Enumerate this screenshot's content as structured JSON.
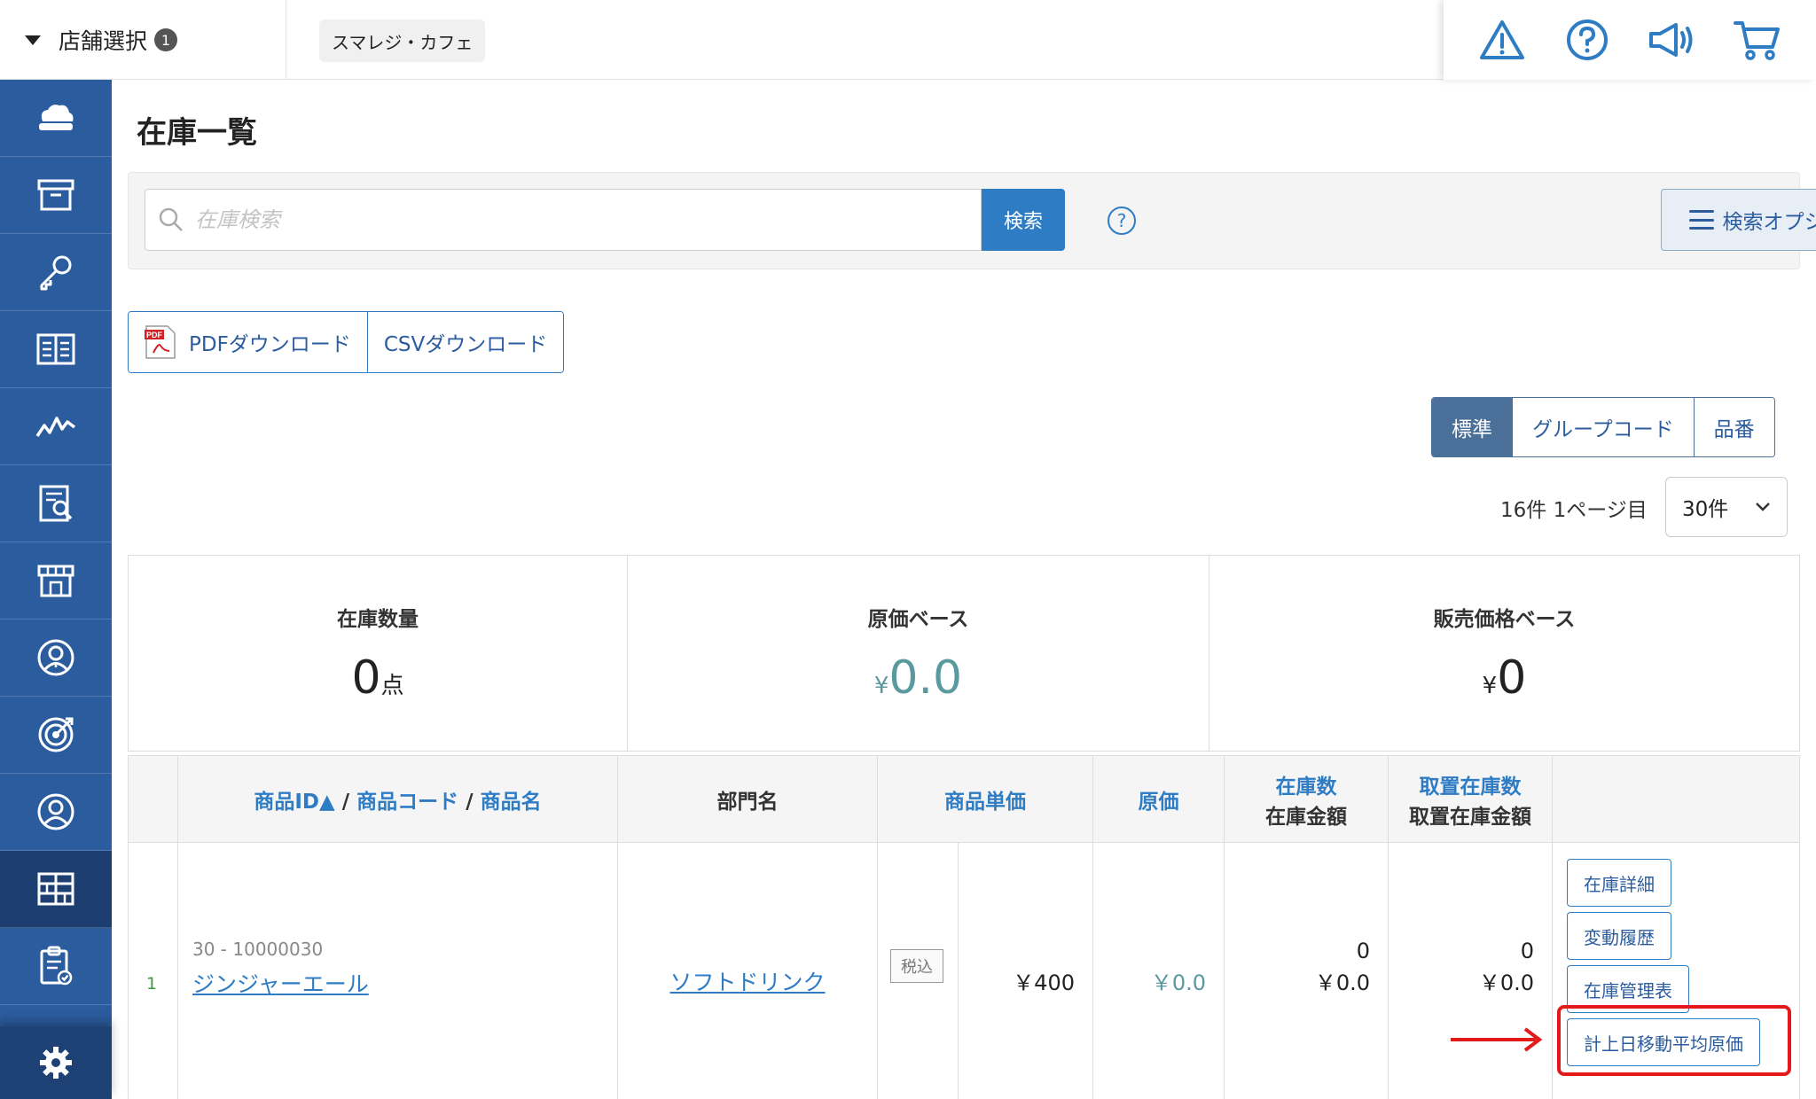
{
  "header": {
    "store_select_label": "店舗選択",
    "store_count": "1",
    "store_chip": "スマレジ・カフェ",
    "icons": [
      "warning-icon",
      "help-icon",
      "megaphone-icon",
      "cart-icon"
    ]
  },
  "sidebar": {
    "items": [
      "cloud-register-icon",
      "archive-icon",
      "key-icon",
      "book-icon",
      "chart-icon",
      "report-icon",
      "store-icon",
      "staff-icon",
      "target-icon",
      "customer-icon",
      "inventory-icon",
      "clipboard-icon"
    ],
    "active_index": 10,
    "settings_icon": "gear-icon"
  },
  "page": {
    "title": "在庫一覧"
  },
  "search": {
    "placeholder": "在庫検索",
    "button": "検索",
    "help": "?",
    "options_button": "検索オプション"
  },
  "downloads": {
    "pdf": "PDFダウンロード",
    "csv": "CSVダウンロード",
    "pdf_badge": "PDF"
  },
  "view_tabs": [
    {
      "label": "標準",
      "active": true
    },
    {
      "label": "グループコード",
      "active": false
    },
    {
      "label": "品番",
      "active": false
    }
  ],
  "pagination": {
    "info": "16件 1ページ目",
    "per_page": "30件"
  },
  "summary": {
    "stock_qty_label": "在庫数量",
    "stock_qty_value": "0",
    "stock_qty_unit": "点",
    "cost_base_label": "原価ベース",
    "cost_base_currency": "¥",
    "cost_base_value": "0.0",
    "sale_base_label": "販売価格ベース",
    "sale_base_currency": "¥",
    "sale_base_value": "0"
  },
  "table": {
    "headers": {
      "product_id": "商品ID",
      "sort_mark": "▲",
      "sep": "/",
      "product_code": "商品コード",
      "product_name": "商品名",
      "department": "部門名",
      "unit_price": "商品単価",
      "cost": "原価",
      "stock_qty": "在庫数",
      "stock_amount": "在庫金額",
      "reserved_qty": "取置在庫数",
      "reserved_amount": "取置在庫金額"
    },
    "rows": [
      {
        "num": "1",
        "product_id_code": "30 - 10000030",
        "product_name": "ジンジャーエール",
        "department": "ソフトドリンク",
        "tax": "税込",
        "unit_price": "￥400",
        "cost": "￥0.0",
        "stock_qty": "0",
        "stock_amount": "￥0.0",
        "reserved_qty": "0",
        "reserved_amount": "￥0.0",
        "actions": [
          "在庫詳細",
          "変動履歴",
          "在庫管理表",
          "計上日移動平均原価"
        ]
      }
    ]
  },
  "colors": {
    "sidebar": "#2b5c9e",
    "accent": "#2e7cc4",
    "highlight": "#e3191a",
    "teal": "#5a9a9e"
  }
}
